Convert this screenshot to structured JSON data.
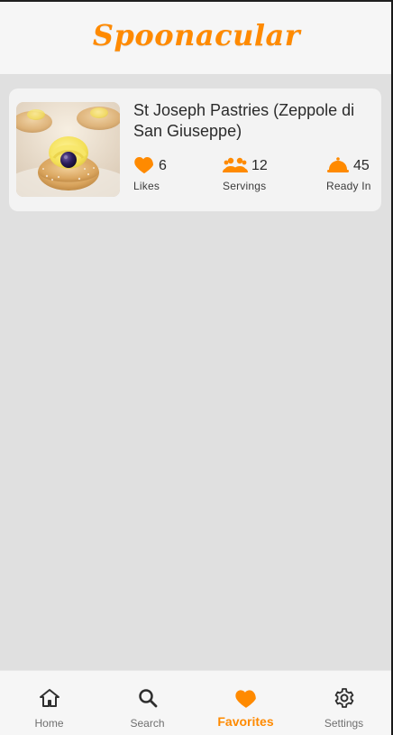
{
  "app": {
    "brand": "Spoonacular",
    "accent_color": "#ff8a00"
  },
  "favorites": {
    "items": [
      {
        "title": "St Joseph Pastries (Zeppole di San Giuseppe)",
        "likes": "6",
        "likes_label": "Likes",
        "servings": "12",
        "servings_label": "Servings",
        "ready_in": "45",
        "ready_in_label": "Ready In",
        "icons": {
          "likes": "heart-icon",
          "servings": "people-icon",
          "ready_in": "cloche-icon"
        }
      }
    ]
  },
  "bottom_nav": {
    "items": [
      {
        "label": "Home",
        "icon": "home-icon",
        "active": false
      },
      {
        "label": "Search",
        "icon": "search-icon",
        "active": false
      },
      {
        "label": "Favorites",
        "icon": "heart-icon",
        "active": true
      },
      {
        "label": "Settings",
        "icon": "gear-icon",
        "active": false
      }
    ]
  }
}
